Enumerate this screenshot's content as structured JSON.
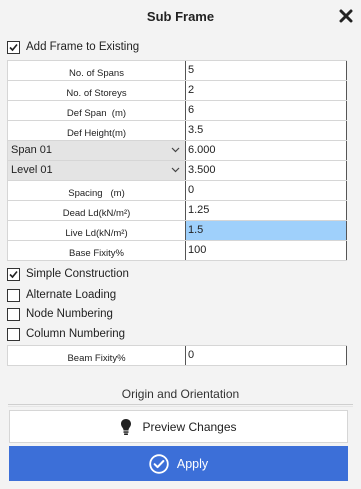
{
  "window": {
    "title": "Sub Frame"
  },
  "add_frame": {
    "label": "Add Frame to Existing",
    "checked": true
  },
  "fields": [
    {
      "label": "No. of Spans",
      "value": "5"
    },
    {
      "label": "No. of Storeys",
      "value": "2"
    },
    {
      "label": "Def Span  (m)",
      "value": "6"
    },
    {
      "label": "Def Height(m)",
      "value": "3.5"
    }
  ],
  "span_select": {
    "selected": "Span 01",
    "value": "6.000"
  },
  "level_select": {
    "selected": "Level 01",
    "value": "3.500"
  },
  "fields2": [
    {
      "label": "Spacing   (m)",
      "value": "0"
    },
    {
      "label": "Dead Ld(kN/m²)",
      "value": "1.25"
    },
    {
      "label": "Live Ld(kN/m²)",
      "value": "1.5"
    },
    {
      "label": "Base Fixity%",
      "value": "100"
    }
  ],
  "options": [
    {
      "label": "Simple Construction",
      "checked": true
    },
    {
      "label": "Alternate Loading",
      "checked": false
    },
    {
      "label": "Node Numbering",
      "checked": false
    },
    {
      "label": "Column Numbering",
      "checked": false
    }
  ],
  "beam_fixity": {
    "label": "Beam Fixity%",
    "value": "0"
  },
  "origin_section": {
    "label": "Origin and Orientation"
  },
  "preview_button": {
    "label": "Preview Changes"
  },
  "apply_button": {
    "label": "Apply",
    "color": "#3c6fd8"
  }
}
